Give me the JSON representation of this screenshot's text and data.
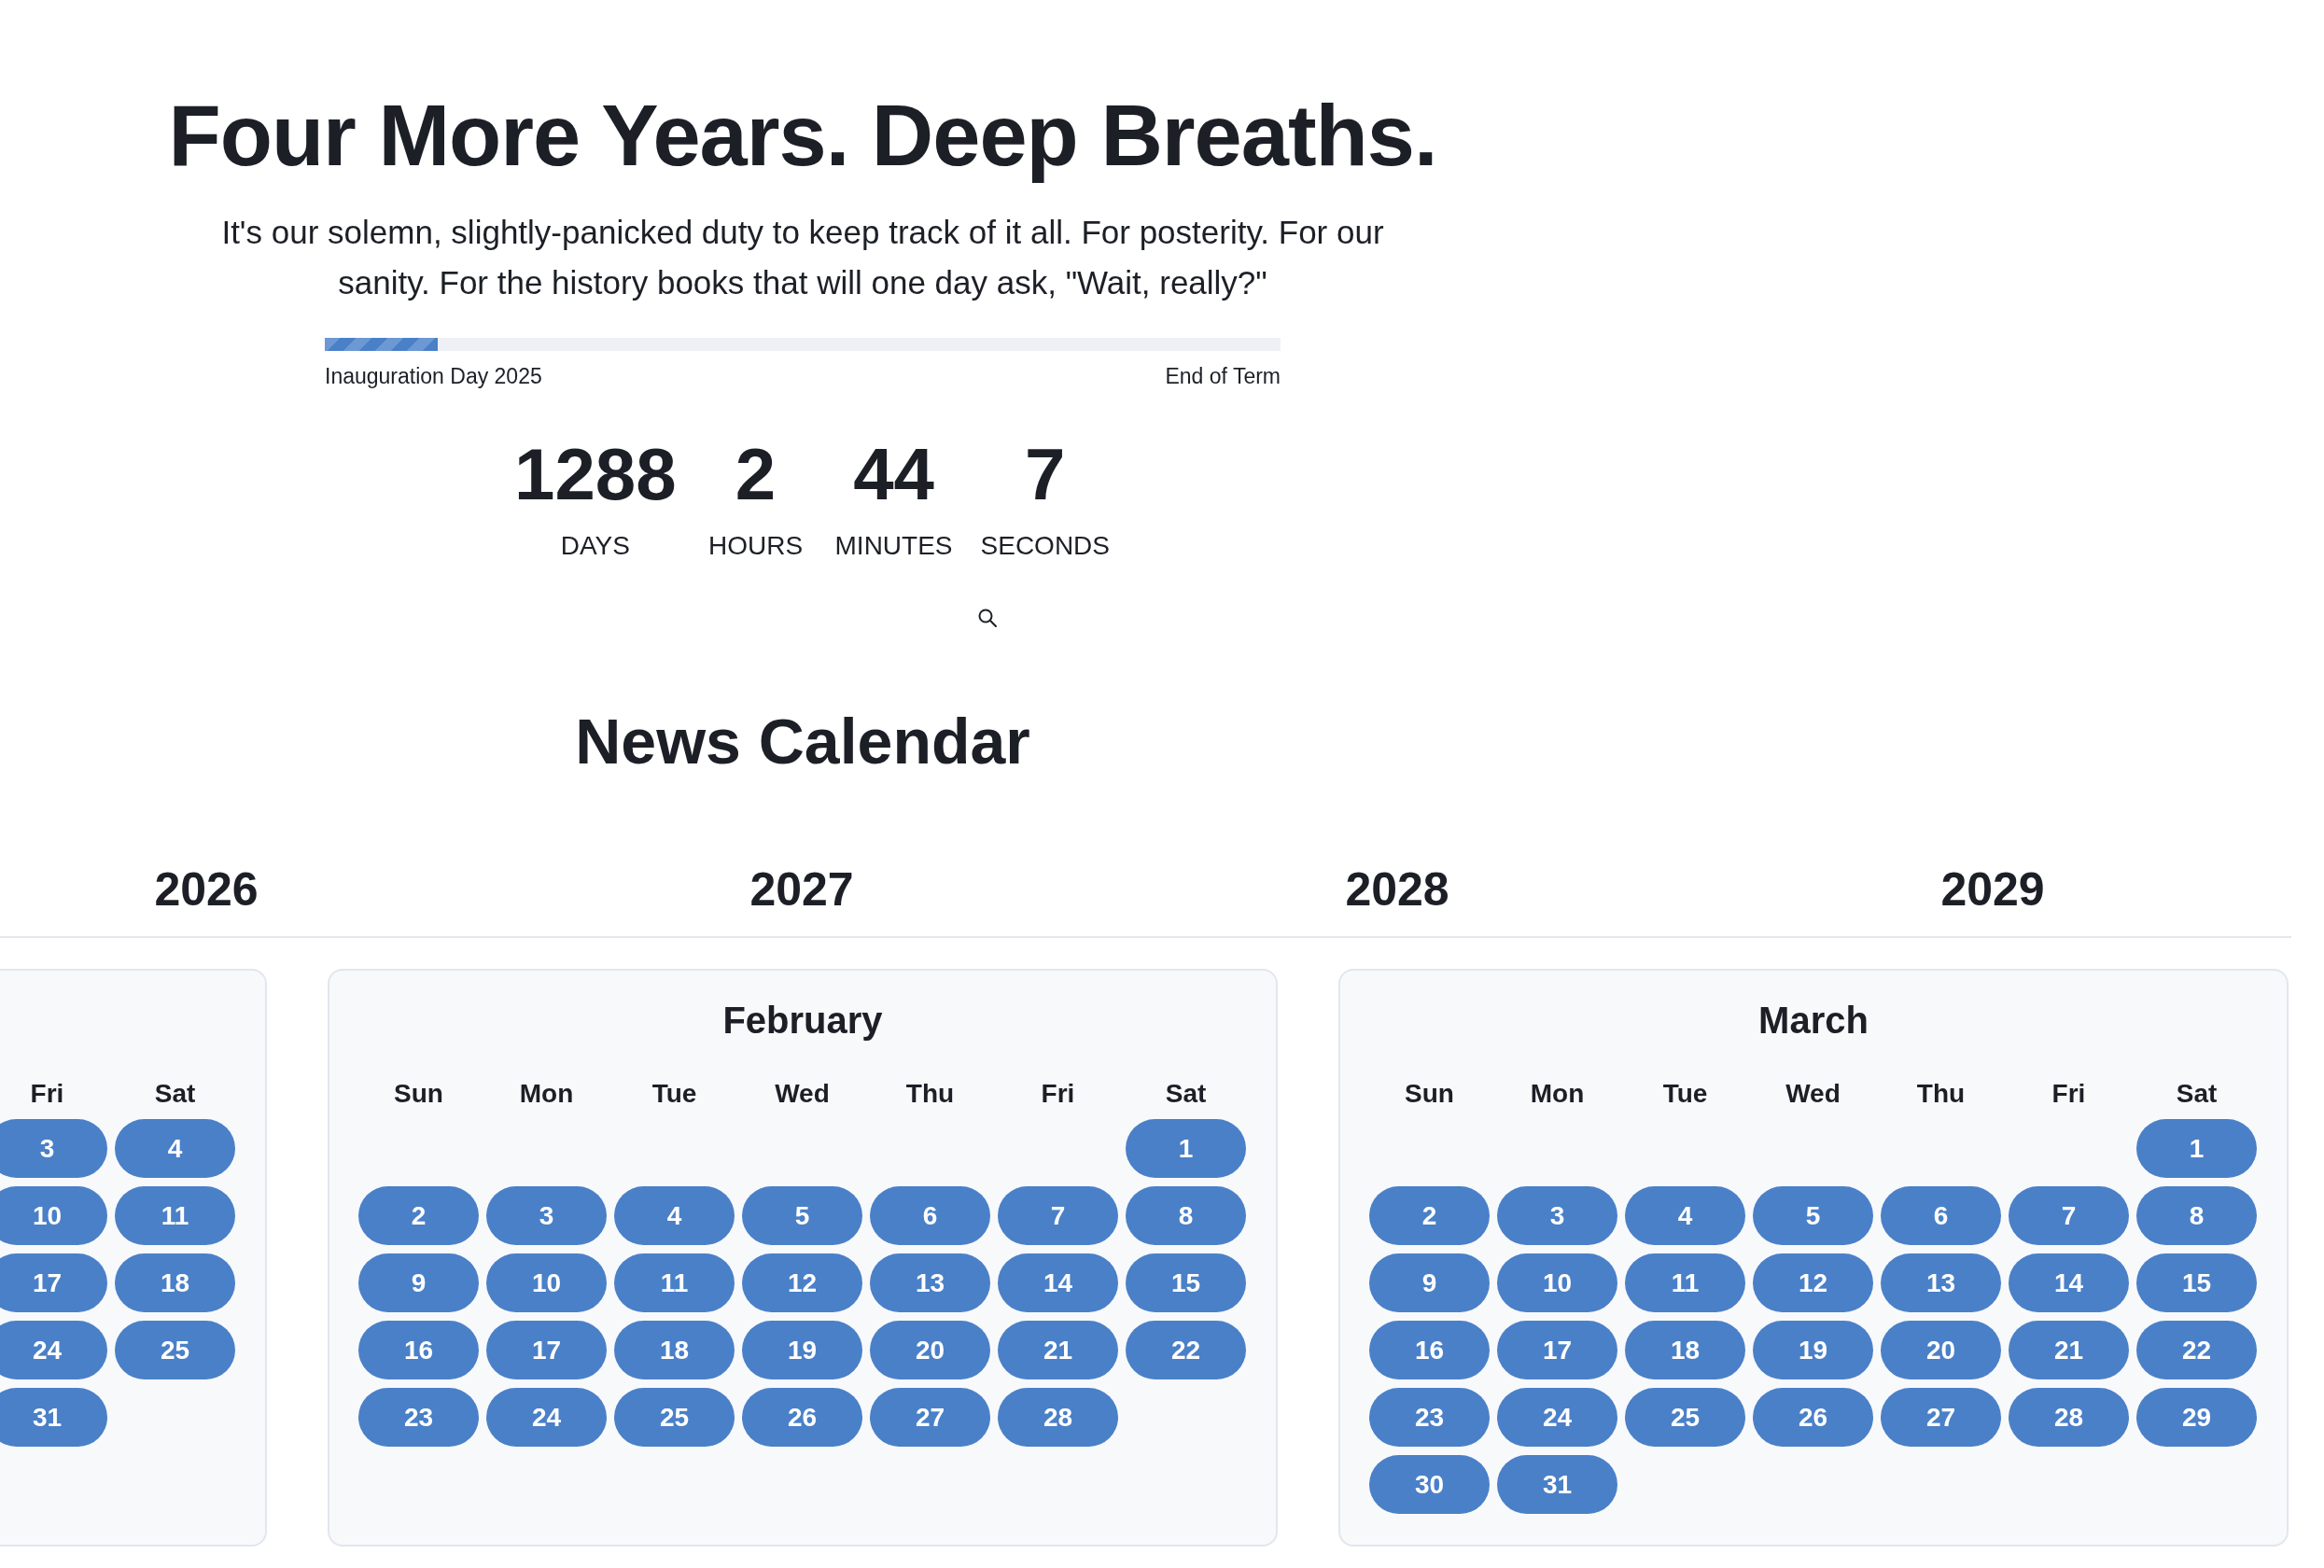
{
  "hero": {
    "title": "Four More Years. Deep Breaths.",
    "subtitle": "It's our solemn, slightly-panicked duty to keep track of it all. For posterity. For our sanity. For the history books that will one day ask, \"Wait, really?\"",
    "progress": {
      "level": 0.118,
      "start_label": "Inauguration Day 2025",
      "end_label": "End of Term"
    },
    "countdown": [
      {
        "value": "1288",
        "unit": "DAYS"
      },
      {
        "value": "2",
        "unit": "HOURS"
      },
      {
        "value": "44",
        "unit": "MINUTES"
      },
      {
        "value": "7",
        "unit": "SECONDS"
      }
    ]
  },
  "calendar": {
    "title": "News Calendar",
    "years": [
      "2026",
      "2027",
      "2028",
      "2029"
    ],
    "months": [
      {
        "weekdays": [
          "Fri",
          "Sat"
        ],
        "weeks": [
          {
            "kind": "week",
            "days": [
              "3",
              "4"
            ]
          },
          {
            "kind": "week",
            "days": [
              "10",
              "11"
            ]
          },
          {
            "kind": "week",
            "days": [
              "17",
              "18"
            ]
          },
          {
            "kind": "week",
            "days": [
              "24",
              "25"
            ]
          },
          {
            "kind": "week",
            "days": [
              "31"
            ]
          }
        ]
      },
      {
        "title": "February",
        "weekdays": [
          "Sun",
          "Mon",
          "Tue",
          "Wed",
          "Thu",
          "Fri",
          "Sat"
        ],
        "weeks": [
          {
            "kind": "first",
            "days": [
              "1"
            ]
          },
          {
            "kind": "week",
            "days": [
              "2",
              "3",
              "4",
              "5",
              "6",
              "7",
              "8"
            ]
          },
          {
            "kind": "week",
            "days": [
              "9",
              "10",
              "11",
              "12",
              "13",
              "14",
              "15"
            ]
          },
          {
            "kind": "week",
            "days": [
              "16",
              "17",
              "18",
              "19",
              "20",
              "21",
              "22"
            ]
          },
          {
            "kind": "week",
            "days": [
              "23",
              "24",
              "25",
              "26",
              "27",
              "28"
            ]
          }
        ]
      },
      {
        "title": "March",
        "weekdays": [
          "Sun",
          "Mon",
          "Tue",
          "Wed",
          "Thu",
          "Fri",
          "Sat"
        ],
        "weeks": [
          {
            "kind": "first",
            "days": [
              "1"
            ]
          },
          {
            "kind": "week",
            "days": [
              "2",
              "3",
              "4",
              "5",
              "6",
              "7",
              "8"
            ]
          },
          {
            "kind": "week",
            "days": [
              "9",
              "10",
              "11",
              "12",
              "13",
              "14",
              "15"
            ]
          },
          {
            "kind": "week",
            "days": [
              "16",
              "17",
              "18",
              "19",
              "20",
              "21",
              "22"
            ]
          },
          {
            "kind": "week",
            "days": [
              "23",
              "24",
              "25",
              "26",
              "27",
              "28",
              "29"
            ]
          },
          {
            "kind": "week",
            "days": [
              "30",
              "31"
            ]
          }
        ]
      }
    ]
  }
}
